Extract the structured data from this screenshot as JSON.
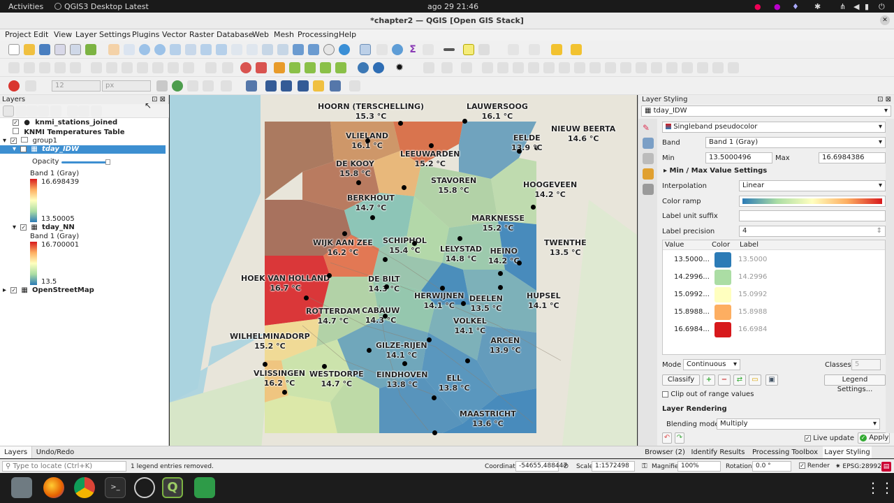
{
  "topbar": {
    "activities": "Activities",
    "app": "QGIS3 Desktop Latest",
    "clock": "ago 29  21:46"
  },
  "window": {
    "title": "*chapter2 — QGIS [Open GIS Stack]",
    "close": "✕"
  },
  "menu": [
    "Project",
    "Edit",
    "View",
    "Layer",
    "Settings",
    "Plugins",
    "Vector",
    "Raster",
    "Database",
    "Web",
    "Mesh",
    "Processing",
    "Help"
  ],
  "toolbar": {
    "size_value": "12",
    "size_unit": "px"
  },
  "layers": {
    "title": "Layers",
    "items": [
      {
        "label": "knmi_stations_joined",
        "bold": true
      },
      {
        "label": "KNMI Temperatures Table",
        "bold": true
      },
      {
        "label": "group1",
        "bold": false
      },
      {
        "label": "tday_IDW",
        "bold": true
      },
      {
        "label": "tday_NN",
        "bold": true
      },
      {
        "label": "OpenStreetMap",
        "bold": true
      }
    ],
    "opacity_label": "Opacity",
    "idw_band": "Band 1 (Gray)",
    "idw_max": "16.698439",
    "idw_min": "13.50005",
    "nn_band": "Band 1 (Gray)",
    "nn_max": "16.700001",
    "nn_min": "13.5"
  },
  "map": {
    "colors": {
      "c1": "#2c7bb6",
      "c2": "#abdda4",
      "c3": "#ffffbf",
      "c4": "#fdae61",
      "c5": "#d7191c"
    },
    "labels": [
      {
        "name": "HOORN (TERSCHELLING)",
        "temp": "15.3 °C"
      },
      {
        "name": "LAUWERSOOG",
        "temp": "16.1 °C"
      },
      {
        "name": "NIEUW BEERTA",
        "temp": "14.6 °C"
      },
      {
        "name": "VLIELAND",
        "temp": "16.1 °C"
      },
      {
        "name": "EELDE",
        "temp": "13.9 °C"
      },
      {
        "name": "LEEUWARDEN",
        "temp": "15.2 °C"
      },
      {
        "name": "DE KOOY",
        "temp": "15.8 °C"
      },
      {
        "name": "STAVOREN",
        "temp": "15.8 °C"
      },
      {
        "name": "HOOGEVEEN",
        "temp": "14.2 °C"
      },
      {
        "name": "BERKHOUT",
        "temp": "14.7 °C"
      },
      {
        "name": "MARKNESSE",
        "temp": "15.2 °C"
      },
      {
        "name": "WIJK AAN ZEE",
        "temp": "16.2 °C"
      },
      {
        "name": "SCHIPHOL",
        "temp": "15.4 °C"
      },
      {
        "name": "LELYSTAD",
        "temp": "14.8 °C"
      },
      {
        "name": "HEINO",
        "temp": "14.2 °C"
      },
      {
        "name": "TWENTHE",
        "temp": "13.5 °C"
      },
      {
        "name": "HOEK VAN HOLLAND",
        "temp": "16.7 °C"
      },
      {
        "name": "DE BILT",
        "temp": "14.3 °C"
      },
      {
        "name": "HERWIJNEN",
        "temp": "14.1 °C"
      },
      {
        "name": "DEELEN",
        "temp": "13.5 °C"
      },
      {
        "name": "HUPSEL",
        "temp": "14.1 °C"
      },
      {
        "name": "ROTTERDAM",
        "temp": "14.7 °C"
      },
      {
        "name": "CABAUW",
        "temp": "14.3 °C"
      },
      {
        "name": "VOLKEL",
        "temp": "14.1 °C"
      },
      {
        "name": "WILHELMINADORP",
        "temp": "15.2 °C"
      },
      {
        "name": "GILZE-RIJEN",
        "temp": "14.1 °C"
      },
      {
        "name": "ARCEN",
        "temp": "13.9 °C"
      },
      {
        "name": "VLISSINGEN",
        "temp": "16.2 °C"
      },
      {
        "name": "WESTDORPE",
        "temp": "14.7 °C"
      },
      {
        "name": "EINDHOVEN",
        "temp": "13.8 °C"
      },
      {
        "name": "ELL",
        "temp": "13.8 °C"
      },
      {
        "name": "MAASTRICHT",
        "temp": "13.6 °C"
      }
    ]
  },
  "styling": {
    "title": "Layer Styling",
    "layer": "tday_IDW",
    "renderer": "Singleband pseudocolor",
    "band_label": "Band",
    "band": "Band 1 (Gray)",
    "min_label": "Min",
    "min": "13.5000496",
    "max_label": "Max",
    "max": "16.6984386",
    "minmax": "Min / Max Value Settings",
    "interp_label": "Interpolation",
    "interp": "Linear",
    "ramp_label": "Color ramp",
    "suffix_label": "Label unit suffix",
    "precision_label": "Label precision",
    "precision": "4",
    "col_value": "Value",
    "col_color": "Color",
    "col_label": "Label",
    "rows": [
      {
        "value": "13.5000...",
        "label": "13.5000",
        "color": "#2c7bb6"
      },
      {
        "value": "14.2996...",
        "label": "14.2996",
        "color": "#abdda4"
      },
      {
        "value": "15.0992...",
        "label": "15.0992",
        "color": "#ffffbf"
      },
      {
        "value": "15.8988...",
        "label": "15.8988",
        "color": "#fdae61"
      },
      {
        "value": "16.6984...",
        "label": "16.6984",
        "color": "#d7191c"
      }
    ],
    "mode_label": "Mode",
    "mode": "Continuous",
    "classes_label": "Classes",
    "classes": "5",
    "classify": "Classify",
    "legend_settings": "Legend Settings...",
    "clip": "Clip out of range values",
    "rendering": "Layer Rendering",
    "blend_label": "Blending mode",
    "blend": "Multiply",
    "live": "Live update",
    "apply": "Apply"
  },
  "bottom_tabs_left": [
    "Layers",
    "Undo/Redo"
  ],
  "bottom_tabs_right": [
    "Browser (2)",
    "Identify Results",
    "Processing Toolbox",
    "Layer Styling"
  ],
  "status": {
    "locate": "Type to locate (Ctrl+K)",
    "message": "1 legend entries removed.",
    "coord_label": "Coordinate",
    "coord": "-54655,488447",
    "scale_label": "Scale",
    "scale": "1:1572498",
    "magnifier_label": "Magnifier",
    "magnifier": "100%",
    "rotation_label": "Rotation",
    "rotation": "0.0 °",
    "render": "Render",
    "crs": "EPSG:28992"
  }
}
